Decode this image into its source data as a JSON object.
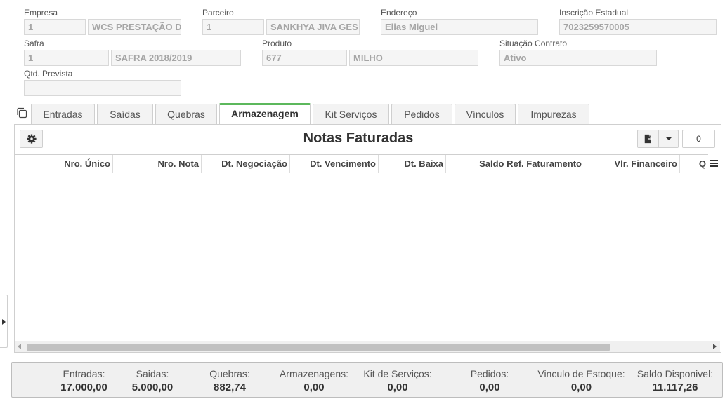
{
  "form": {
    "empresa": {
      "label": "Empresa",
      "code": "1",
      "name": "WCS PRESTAÇÃO D"
    },
    "parceiro": {
      "label": "Parceiro",
      "code": "1",
      "name": "SANKHYA JIVA GES"
    },
    "endereco": {
      "label": "Endereço",
      "value": "Elias Miguel"
    },
    "inscricao": {
      "label": "Inscrição Estadual",
      "value": "7023259570005"
    },
    "safra": {
      "label": "Safra",
      "code": "1",
      "name": "SAFRA 2018/2019"
    },
    "produto": {
      "label": "Produto",
      "code": "677",
      "name": "MILHO"
    },
    "situacao": {
      "label": "Situação Contrato",
      "value": "Ativo"
    },
    "qtd": {
      "label": "Qtd. Prevista",
      "value": ""
    }
  },
  "tabs": [
    {
      "label": "Entradas"
    },
    {
      "label": "Saídas"
    },
    {
      "label": "Quebras"
    },
    {
      "label": "Armazenagem"
    },
    {
      "label": "Kit Serviços"
    },
    {
      "label": "Pedidos"
    },
    {
      "label": "Vínculos"
    },
    {
      "label": "Impurezas"
    }
  ],
  "panel": {
    "title": "Notas Faturadas",
    "record_count": "0"
  },
  "grid": {
    "columns": [
      "Nro. Único",
      "Nro. Nota",
      "Dt. Negociação",
      "Dt. Vencimento",
      "Dt. Baixa",
      "Saldo Ref. Faturamento",
      "Vlr. Financeiro",
      "Q"
    ]
  },
  "summary": [
    {
      "label": "Entradas:",
      "value": "17.000,00"
    },
    {
      "label": "Saidas:",
      "value": "5.000,00"
    },
    {
      "label": "Quebras:",
      "value": "882,74"
    },
    {
      "label": "Armazenagens:",
      "value": "0,00"
    },
    {
      "label": "Kit de Serviços:",
      "value": "0,00"
    },
    {
      "label": "Pedidos:",
      "value": "0,00"
    },
    {
      "label": "Vinculo de Estoque:",
      "value": "0,00"
    },
    {
      "label": "Saldo Disponivel:",
      "value": "11.117,26"
    }
  ],
  "icons": {
    "copy": "copy-icon",
    "gear": "gear-icon",
    "export": "export-file-icon",
    "dropdown": "chevron-down-icon",
    "column_menu": "menu-icon"
  },
  "colors": {
    "active_tab_accent": "#5cb85c"
  }
}
